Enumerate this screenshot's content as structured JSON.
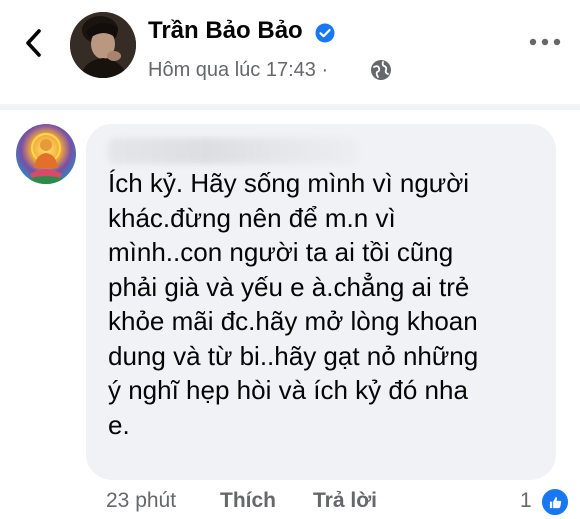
{
  "header": {
    "poster_name": "Trần Bảo Bảo",
    "post_time": "Hôm qua lúc 17:43 ·",
    "icons": {
      "back": "chevron-left-icon",
      "verified": "verified-badge-icon",
      "privacy": "globe-icon",
      "more": "more-dots-icon"
    }
  },
  "comment": {
    "commenter_name": "",
    "text": "Ích kỷ. Hãy sống mình vì người\nkhác.đừng nên để m.n vì\nmình..con người ta ai tồi cũng\nphải già và yếu e à.chẳng ai trẻ\nkhỏe mãi đc.hãy mở lòng khoan\ndung và từ bi..hãy gạt nỏ những\ný nghĩ hẹp hòi và ích kỷ đó nha\ne."
  },
  "actions": {
    "time": "23 phút",
    "like_label": "Thích",
    "reply_label": "Trả lời",
    "reaction_count": "1",
    "reaction_icon": "like-thumb-icon"
  },
  "colors": {
    "bubble": "#f0f2f5",
    "secondary_text": "#65676b",
    "facebook_blue": "#1877f2"
  }
}
